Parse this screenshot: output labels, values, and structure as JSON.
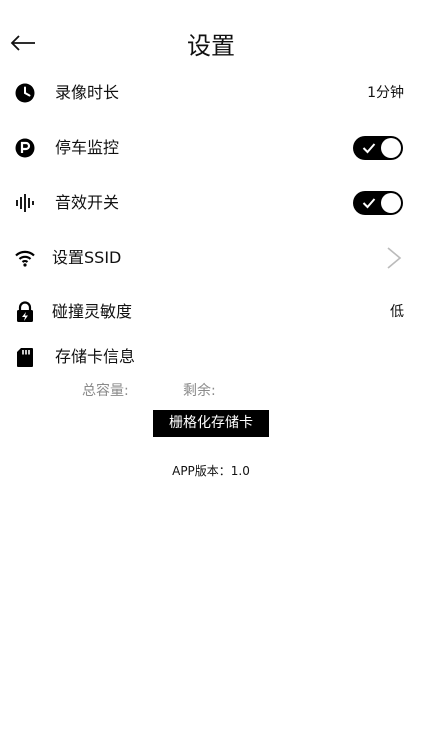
{
  "header": {
    "title": "设置",
    "back_icon": "arrow-left-icon"
  },
  "settings": {
    "record_duration": {
      "label": "录像时长",
      "value": "1分钟",
      "icon": "clock-icon"
    },
    "parking_monitor": {
      "label": "停车监控",
      "enabled": true,
      "icon": "parking-icon"
    },
    "sound_effect": {
      "label": "音效开关",
      "enabled": true,
      "icon": "sound-wave-icon"
    },
    "ssid": {
      "label": "设置SSID",
      "icon": "wifi-icon",
      "action_icon": "chevron-right-icon"
    },
    "collision_sensitivity": {
      "label": "碰撞灵敏度",
      "value": "低",
      "icon": "lock-bolt-icon"
    },
    "storage": {
      "label": "存储卡信息",
      "icon": "sd-card-icon",
      "total_label": "总容量:",
      "remaining_label": "剩余:"
    }
  },
  "actions": {
    "format_label": "栅格化存储卡"
  },
  "footer": {
    "version": "APP版本：1.0"
  },
  "colors": {
    "accent": "#000000",
    "muted": "#8a8a8a",
    "background": "#ffffff"
  }
}
